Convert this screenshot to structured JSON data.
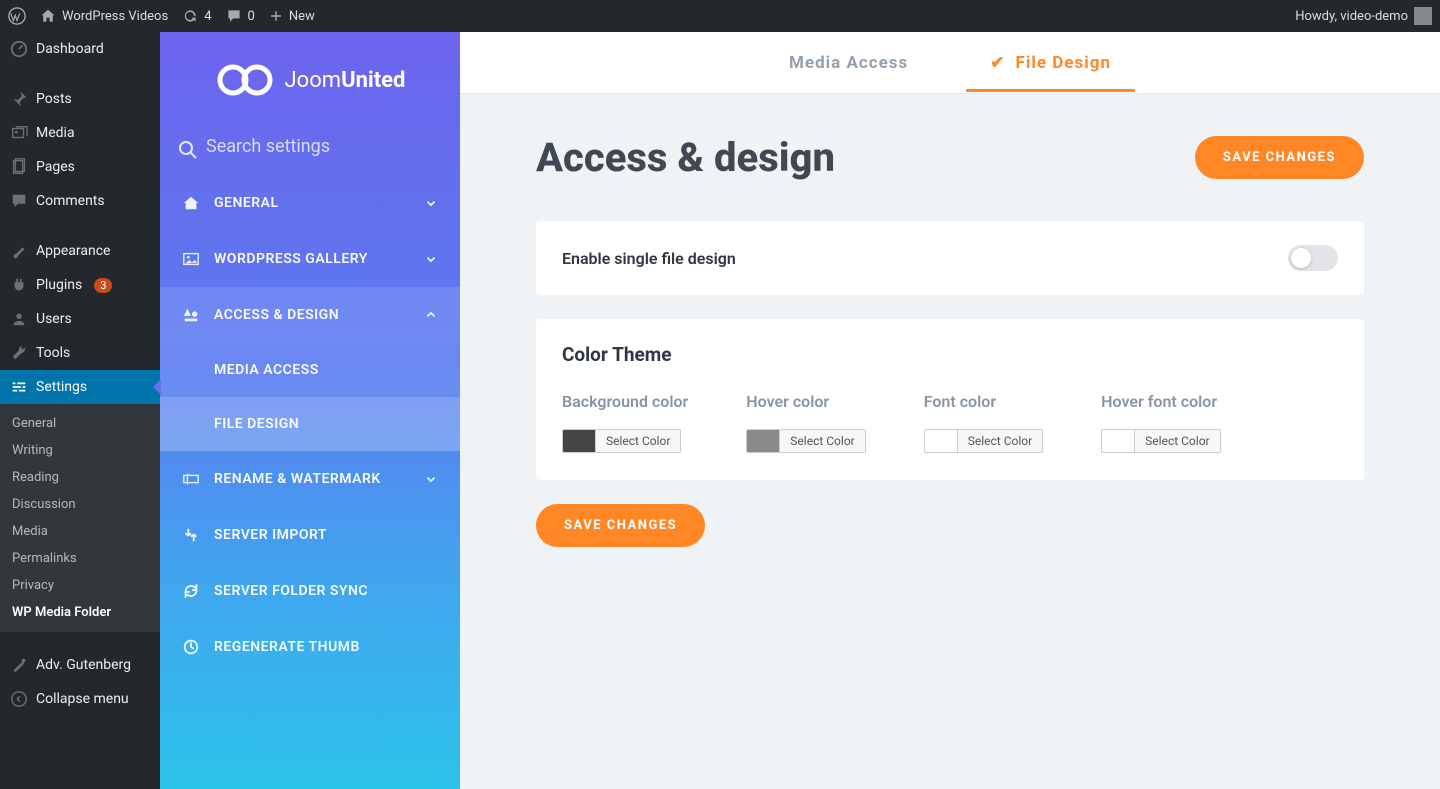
{
  "adminBar": {
    "siteName": "WordPress Videos",
    "updates": "4",
    "comments": "0",
    "newLabel": "New",
    "howdy": "Howdy, video-demo"
  },
  "wpMenu": {
    "dashboard": "Dashboard",
    "posts": "Posts",
    "media": "Media",
    "pages": "Pages",
    "comments": "Comments",
    "appearance": "Appearance",
    "plugins": "Plugins",
    "pluginsBadge": "3",
    "users": "Users",
    "tools": "Tools",
    "settings": "Settings",
    "advGutenberg": "Adv. Gutenberg",
    "collapse": "Collapse menu"
  },
  "wpSubmenu": {
    "general": "General",
    "writing": "Writing",
    "reading": "Reading",
    "discussion": "Discussion",
    "media": "Media",
    "permalinks": "Permalinks",
    "privacy": "Privacy",
    "wpMediaFolder": "WP Media Folder"
  },
  "ju": {
    "logoPart1": "Joom",
    "logoPart2": "United",
    "searchPlaceholder": "Search settings",
    "menu": {
      "general": "GENERAL",
      "wordpressGallery": "WORDPRESS GALLERY",
      "accessDesign": "ACCESS & DESIGN",
      "renameWatermark": "RENAME & WATERMARK",
      "serverImport": "SERVER IMPORT",
      "serverFolderSync": "SERVER FOLDER SYNC",
      "regenerateThumb": "REGENERATE THUMB"
    },
    "submenu": {
      "mediaAccess": "MEDIA ACCESS",
      "fileDesign": "FILE DESIGN"
    }
  },
  "tabs": {
    "mediaAccess": "Media Access",
    "fileDesign": "File Design"
  },
  "page": {
    "title": "Access & design",
    "saveChanges": "SAVE CHANGES",
    "enableSingleFile": "Enable single file design",
    "colorTheme": "Color Theme",
    "backgroundColor": "Background color",
    "hoverColor": "Hover color",
    "fontColor": "Font color",
    "hoverFontColor": "Hover font color",
    "selectColor": "Select Color"
  }
}
